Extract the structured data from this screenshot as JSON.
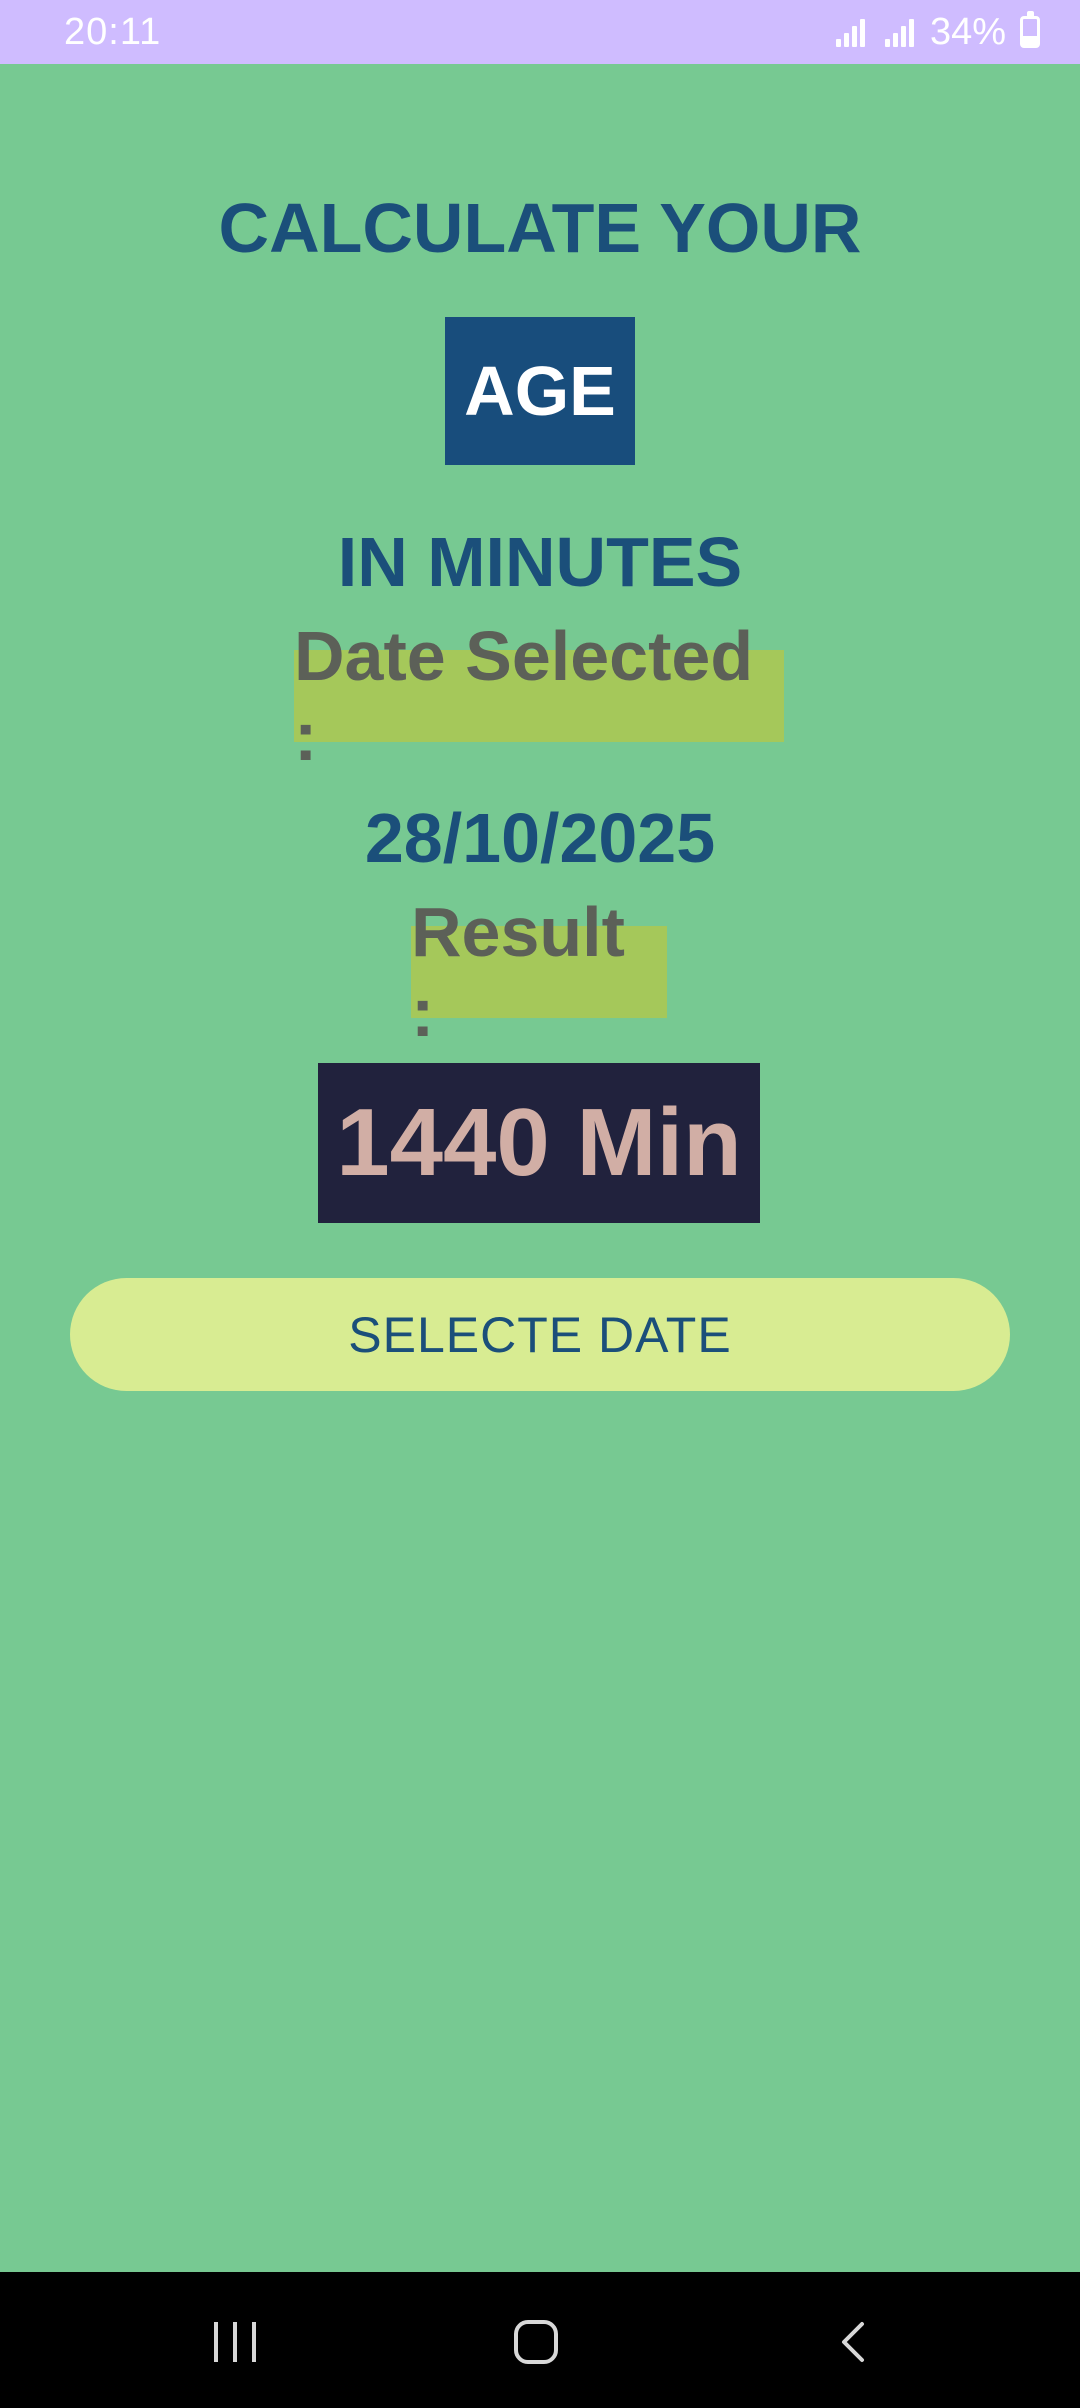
{
  "status_bar": {
    "time": "20:11",
    "battery_percent": "34%",
    "icons": [
      "signal-icon",
      "signal-icon",
      "battery-icon"
    ]
  },
  "header": {
    "line1": "CALCULATE YOUR",
    "highlight": "AGE",
    "line2": "IN MINUTES"
  },
  "date": {
    "label": "Date Selected :",
    "value": "28/10/2025"
  },
  "result": {
    "label": "Result :",
    "value": "1440 Min"
  },
  "actions": {
    "select_date_label": "SELECTE DATE"
  },
  "nav_bar": {
    "icons": [
      "recents-icon",
      "home-icon",
      "back-icon"
    ]
  },
  "colors": {
    "background": "#77c992",
    "status_bar": "#cfbcff",
    "heading_text": "#1b4f7a",
    "age_box": "#184d7c",
    "label_highlight": "#a5c85a",
    "result_box": "#21223d",
    "result_text": "#d1aea5",
    "button": "#d8ec92"
  }
}
